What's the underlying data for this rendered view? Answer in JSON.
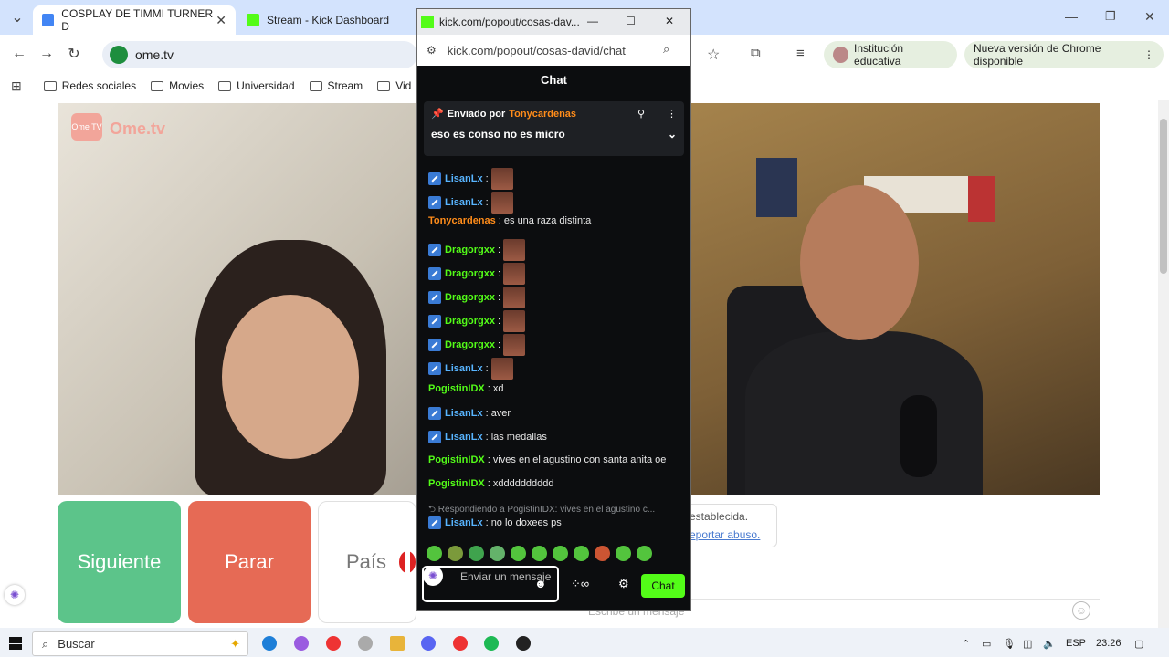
{
  "browser": {
    "tabs": [
      {
        "title": "COSPLAY DE TIMMI TURNER D",
        "active": true
      },
      {
        "title": "Stream - Kick Dashboard",
        "active": false
      }
    ],
    "address": "ome.tv",
    "bookmarks": [
      "Redes sociales",
      "Movies",
      "Universidad",
      "Stream",
      "Vid"
    ],
    "profile_label": "Institución educativa",
    "update_label": "Nueva versión de Chrome disponible"
  },
  "ometv": {
    "logo_badge": "Ome TV",
    "logo_text": "Ome.tv",
    "next_label": "Siguiente",
    "stop_label": "Parar",
    "country_label": "País",
    "status_text": "establecida.",
    "report_link": "eportar abuso.",
    "message_placeholder": "Escribe un mensaje"
  },
  "popup": {
    "title": "kick.com/popout/cosas-dav...",
    "url": "kick.com/popout/cosas-david/chat",
    "chat_header": "Chat",
    "pinned_by_label": "Enviado por",
    "pinned_user": "Tonycardenas",
    "pinned_text": "eso es conso no es micro",
    "messages": [
      {
        "user": "LisanLx",
        "text": ":",
        "badge": true,
        "emote": true,
        "color": "blue"
      },
      {
        "user": "LisanLx",
        "text": ":",
        "badge": true,
        "emote": true,
        "color": "blue"
      },
      {
        "user": "Tonycardenas",
        "text": ": es una raza distinta",
        "badge": false,
        "emote": false,
        "color": "orange"
      },
      {
        "user": "Dragorgxx",
        "text": ":",
        "badge": true,
        "emote": true,
        "color": "green"
      },
      {
        "user": "Dragorgxx",
        "text": ":",
        "badge": true,
        "emote": true,
        "color": "green"
      },
      {
        "user": "Dragorgxx",
        "text": ":",
        "badge": true,
        "emote": true,
        "color": "green"
      },
      {
        "user": "Dragorgxx",
        "text": ":",
        "badge": true,
        "emote": true,
        "color": "green"
      },
      {
        "user": "Dragorgxx",
        "text": ":",
        "badge": true,
        "emote": true,
        "color": "green"
      },
      {
        "user": "LisanLx",
        "text": ":",
        "badge": true,
        "emote": true,
        "color": "blue"
      },
      {
        "user": "PogistinIDX",
        "text": ": xd",
        "badge": false,
        "emote": false,
        "color": "green"
      },
      {
        "user": "LisanLx",
        "text": ": aver",
        "badge": true,
        "emote": false,
        "color": "blue"
      },
      {
        "user": "LisanLx",
        "text": ": las medallas",
        "badge": true,
        "emote": false,
        "color": "blue"
      },
      {
        "user": "PogistinIDX",
        "text": ": vives en el agustino con santa anita oe",
        "badge": false,
        "emote": false,
        "color": "green"
      },
      {
        "user": "PogistinIDX",
        "text": ": xdddddddddd",
        "badge": false,
        "emote": false,
        "color": "green"
      }
    ],
    "reply_note": "Respondiendo a PogistinIDX: vives en el agustino c...",
    "last_message": {
      "user": "LisanLx",
      "text": ": no lo doxees ps"
    },
    "input_placeholder": "Enviar un mensaje",
    "send_label": "Chat"
  },
  "taskbar": {
    "search_label": "Buscar",
    "language": "ESP",
    "time": "23:26"
  },
  "colors": {
    "kick_green": "#53fc18",
    "next_green": "#5cc48a",
    "stop_red": "#e66a55"
  }
}
